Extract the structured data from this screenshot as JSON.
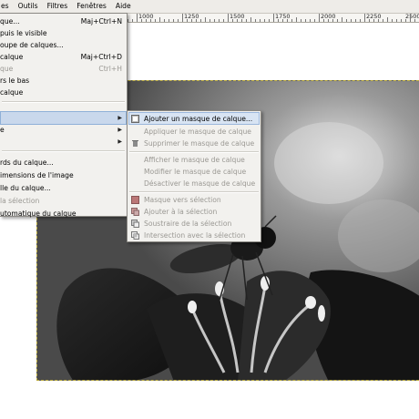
{
  "menubar": {
    "items": [
      "es",
      "Outils",
      "Filtres",
      "Fenêtres",
      "Aide"
    ]
  },
  "ruler": {
    "labels": [
      "1000",
      "1250",
      "1500",
      "1750",
      "2000",
      "2250",
      "2500"
    ]
  },
  "main_menu": {
    "items": [
      {
        "label": "que...",
        "shortcut": "Maj+Ctrl+N",
        "disabled": false
      },
      {
        "label": "puis le visible",
        "shortcut": "",
        "disabled": false
      },
      {
        "label": "oupe de calques...",
        "shortcut": "",
        "disabled": false
      },
      {
        "label": "calque",
        "shortcut": "Maj+Ctrl+D",
        "disabled": false
      },
      {
        "label": "que",
        "shortcut": "Ctrl+H",
        "disabled": true
      },
      {
        "label": "rs le bas",
        "shortcut": "",
        "disabled": false
      },
      {
        "label": "calque",
        "shortcut": "",
        "disabled": false
      },
      {
        "label": "",
        "shortcut": "",
        "disabled": false
      },
      {
        "label": "",
        "shortcut": "",
        "disabled": false
      },
      {
        "label": "e",
        "shortcut": "",
        "disabled": false
      },
      {
        "label": "",
        "shortcut": "",
        "disabled": false
      },
      {
        "label": "rds du calque...",
        "shortcut": "",
        "disabled": false
      },
      {
        "label": "imensions de l'image",
        "shortcut": "",
        "disabled": false
      },
      {
        "label": "lle du calque...",
        "shortcut": "",
        "disabled": false
      },
      {
        "label": "la sélection",
        "shortcut": "",
        "disabled": true
      },
      {
        "label": "utomatique du calque",
        "shortcut": "",
        "disabled": false
      }
    ]
  },
  "sub_menu": {
    "items": [
      {
        "label": "Ajouter un masque de calque...",
        "disabled": false,
        "icon": "add-mask-icon"
      },
      {
        "label": "Appliquer le masque de calque",
        "disabled": true,
        "icon": ""
      },
      {
        "label": "Supprimer le masque de calque",
        "disabled": true,
        "icon": "trash-icon"
      },
      {
        "label": "Afficher le masque de calque",
        "disabled": true,
        "icon": ""
      },
      {
        "label": "Modifier le masque de calque",
        "disabled": true,
        "icon": ""
      },
      {
        "label": "Désactiver le masque de calque",
        "disabled": true,
        "icon": ""
      },
      {
        "label": "Masque vers sélection",
        "disabled": true,
        "icon": "mask-to-selection-icon"
      },
      {
        "label": "Ajouter à la sélection",
        "disabled": true,
        "icon": "selection-add-icon"
      },
      {
        "label": "Soustraire de la sélection",
        "disabled": true,
        "icon": "selection-subtract-icon"
      },
      {
        "label": "Intersection avec la sélection",
        "disabled": true,
        "icon": "selection-intersect-icon"
      }
    ]
  },
  "colors": {
    "highlight": "#c9d8ec",
    "menu_bg": "#f2f1ee",
    "disabled_text": "#9a9893",
    "selection_border": "#b9a93a"
  }
}
